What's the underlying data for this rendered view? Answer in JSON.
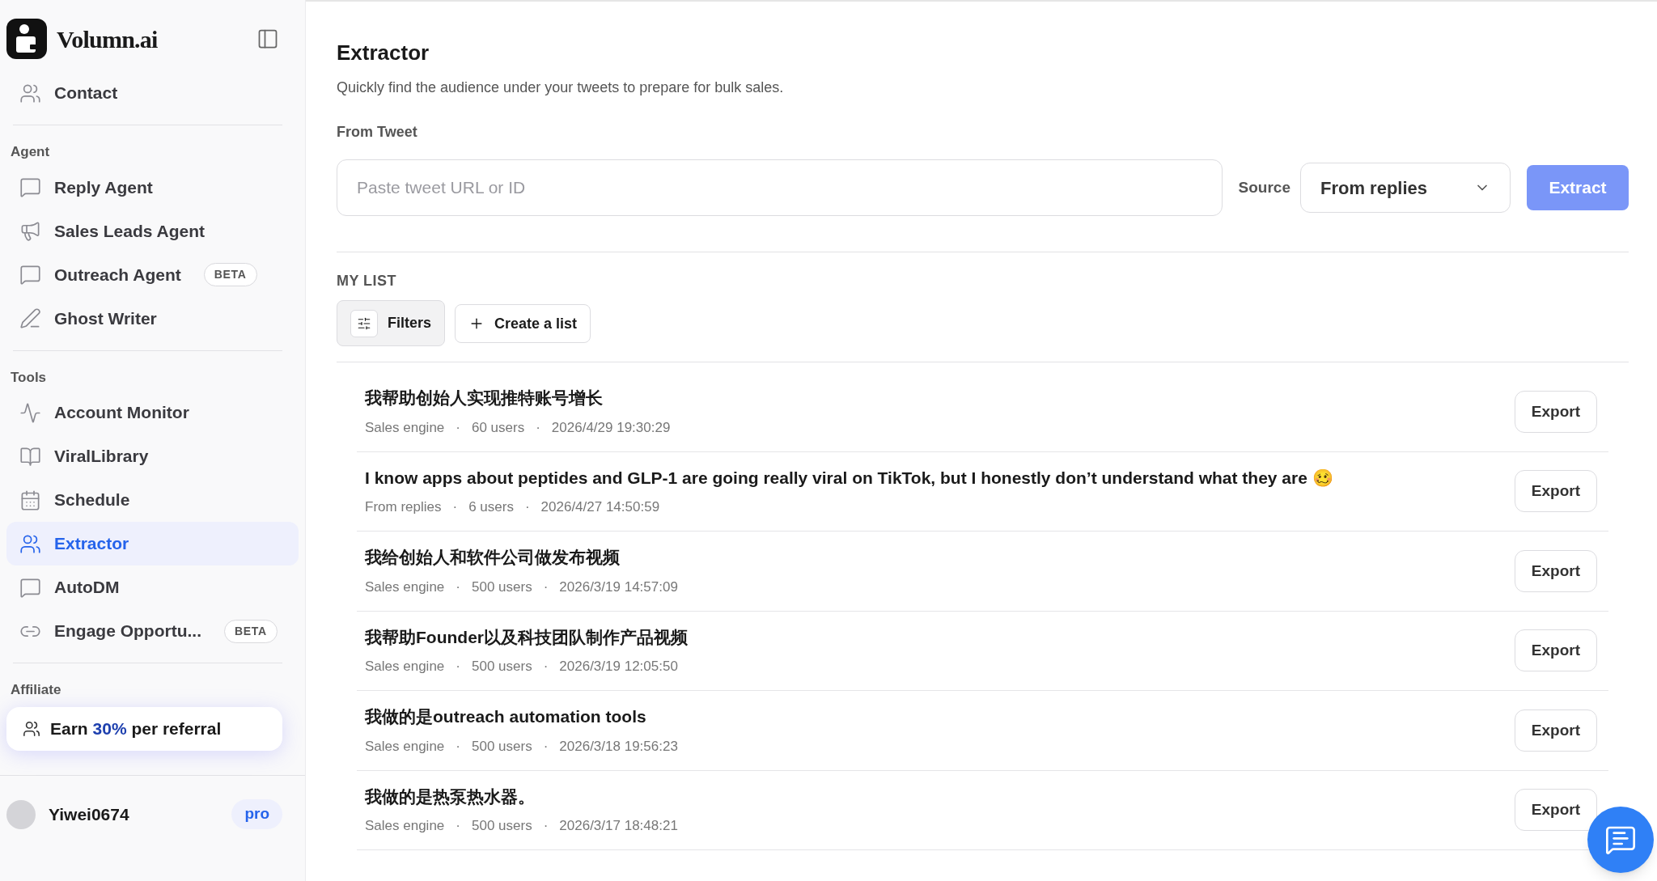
{
  "sidebar": {
    "brand": "Volumn.ai",
    "top_items": [
      {
        "label": "Contact",
        "selected": false
      }
    ],
    "sections": [
      {
        "title": "Agent",
        "items": [
          {
            "label": "Reply Agent",
            "selected": false
          },
          {
            "label": "Sales Leads Agent",
            "selected": false
          },
          {
            "label": "Outreach Agent",
            "selected": false,
            "badge": "BETA"
          },
          {
            "label": "Ghost Writer",
            "selected": false
          }
        ]
      },
      {
        "title": "Tools",
        "items": [
          {
            "label": "Account Monitor",
            "selected": false
          },
          {
            "label": "ViralLibrary",
            "selected": false
          },
          {
            "label": "Schedule",
            "selected": false
          },
          {
            "label": "Extractor",
            "selected": true
          },
          {
            "label": "AutoDM",
            "selected": false
          },
          {
            "label": "Engage Opportu...",
            "selected": false,
            "badge": "BETA"
          }
        ]
      }
    ],
    "affiliate": {
      "title": "Affiliate",
      "prefix": "Earn",
      "highlight": "30%",
      "suffix": "per referral"
    },
    "user": {
      "name": "Yiwei0674",
      "plan": "pro"
    }
  },
  "page": {
    "title": "Extractor",
    "subtitle": "Quickly find the audience under your tweets to prepare for bulk sales.",
    "from_label": "From Tweet",
    "input": {
      "placeholder": "Paste tweet URL or ID"
    },
    "source_label": "Source",
    "source_value": "From replies",
    "extract_button": "Extract",
    "list_heading": "MY LIST",
    "filters_button": "Filters",
    "create_button": "Create a list"
  },
  "rows": [
    {
      "title": "我帮助创始人实现推特账号增长",
      "source": "Sales engine",
      "users": "60 users",
      "time": "2026/4/29 19:30:29",
      "separator": "·",
      "action": "Export"
    },
    {
      "title": "I know apps about peptides and GLP-1 are going really viral on TikTok, but I honestly don’t understand what they are 🥴",
      "source": "From replies",
      "users": "6 users",
      "time": "2026/4/27 14:50:59",
      "separator": "·",
      "action": "Export"
    },
    {
      "title": "我给创始人和软件公司做发布视频",
      "source": "Sales engine",
      "users": "500 users",
      "time": "2026/3/19 14:57:09",
      "separator": "·",
      "action": "Export"
    },
    {
      "title": "我帮助Founder以及科技团队制作产品视频",
      "source": "Sales engine",
      "users": "500 users",
      "time": "2026/3/19 12:05:50",
      "separator": "·",
      "action": "Export"
    },
    {
      "title": "我做的是outreach automation tools",
      "source": "Sales engine",
      "users": "500 users",
      "time": "2026/3/18 19:56:23",
      "separator": "·",
      "action": "Export"
    },
    {
      "title": "我做的是热泵热水器。",
      "source": "Sales engine",
      "users": "500 users",
      "time": "2026/3/17 18:48:21",
      "separator": "·",
      "action": "Export"
    }
  ]
}
